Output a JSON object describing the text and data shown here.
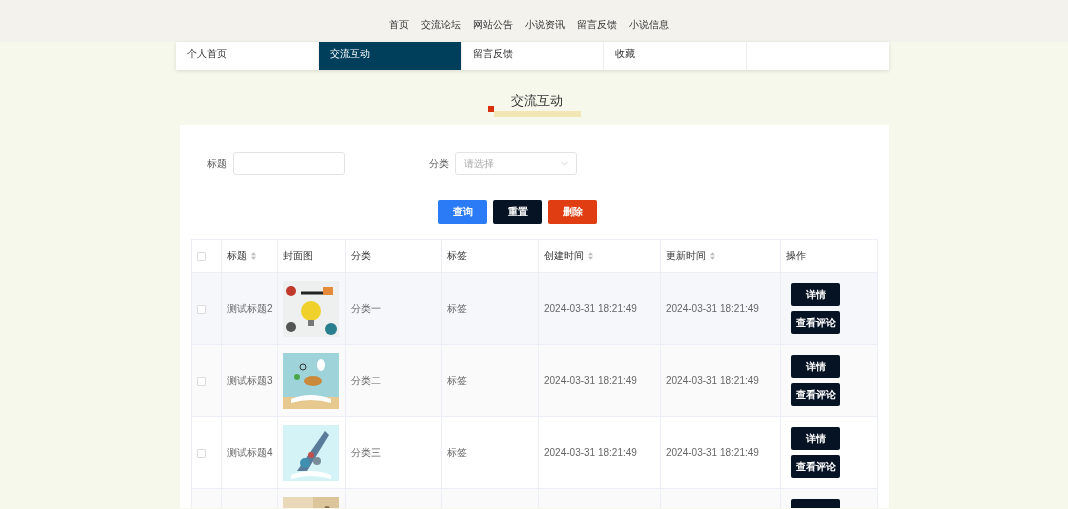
{
  "top_nav": [
    {
      "label": "首页"
    },
    {
      "label": "交流论坛"
    },
    {
      "label": "网站公告"
    },
    {
      "label": "小说资讯"
    },
    {
      "label": "留言反馈"
    },
    {
      "label": "小说信息"
    }
  ],
  "tabs": [
    {
      "label": "个人首页",
      "selected": false
    },
    {
      "label": "交流互动",
      "selected": true
    },
    {
      "label": "留言反馈",
      "selected": false
    },
    {
      "label": "收藏",
      "selected": false
    }
  ],
  "page_title": "交流互动",
  "filters": [
    {
      "kind": "input",
      "label": "标题"
    },
    {
      "kind": "select",
      "label": "分类",
      "placeholder": "请选择"
    }
  ],
  "actions": [
    {
      "label": "查询",
      "kind": "primary"
    },
    {
      "label": "重置",
      "kind": "dark"
    },
    {
      "label": "删除",
      "kind": "danger"
    }
  ],
  "table": {
    "select_all": {
      "checked": false
    },
    "columns": [
      {
        "label": "标题",
        "sortable": true
      },
      {
        "label": "封面图",
        "sortable": false
      },
      {
        "label": "分类",
        "sortable": false
      },
      {
        "label": "标签",
        "sortable": false
      },
      {
        "label": "创建时间",
        "sortable": true
      },
      {
        "label": "更新时间",
        "sortable": true
      },
      {
        "label": "操作",
        "sortable": false
      }
    ],
    "rows": [
      {
        "checked": false,
        "title": "测试标题2",
        "cover": {
          "kind": "picture"
        },
        "category": "分类一",
        "tag": "标签",
        "created": "2024-03-31 18:21:49",
        "updated": "2024-03-31 18:21:49",
        "buttons": [
          "详情",
          "查看评论"
        ]
      },
      {
        "checked": false,
        "title": "测试标题3",
        "cover": {
          "kind": "picture"
        },
        "category": "分类二",
        "tag": "标签",
        "created": "2024-03-31 18:21:49",
        "updated": "2024-03-31 18:21:49",
        "buttons": [
          "详情",
          "查看评论"
        ]
      },
      {
        "checked": false,
        "title": "测试标题4",
        "cover": {
          "kind": "picture"
        },
        "category": "分类三",
        "tag": "标签",
        "created": "2024-03-31 18:21:49",
        "updated": "2024-03-31 18:21:49",
        "buttons": [
          "详情",
          "查看评论"
        ]
      },
      {
        "cover": {
          "kind": "picture"
        }
      }
    ]
  }
}
